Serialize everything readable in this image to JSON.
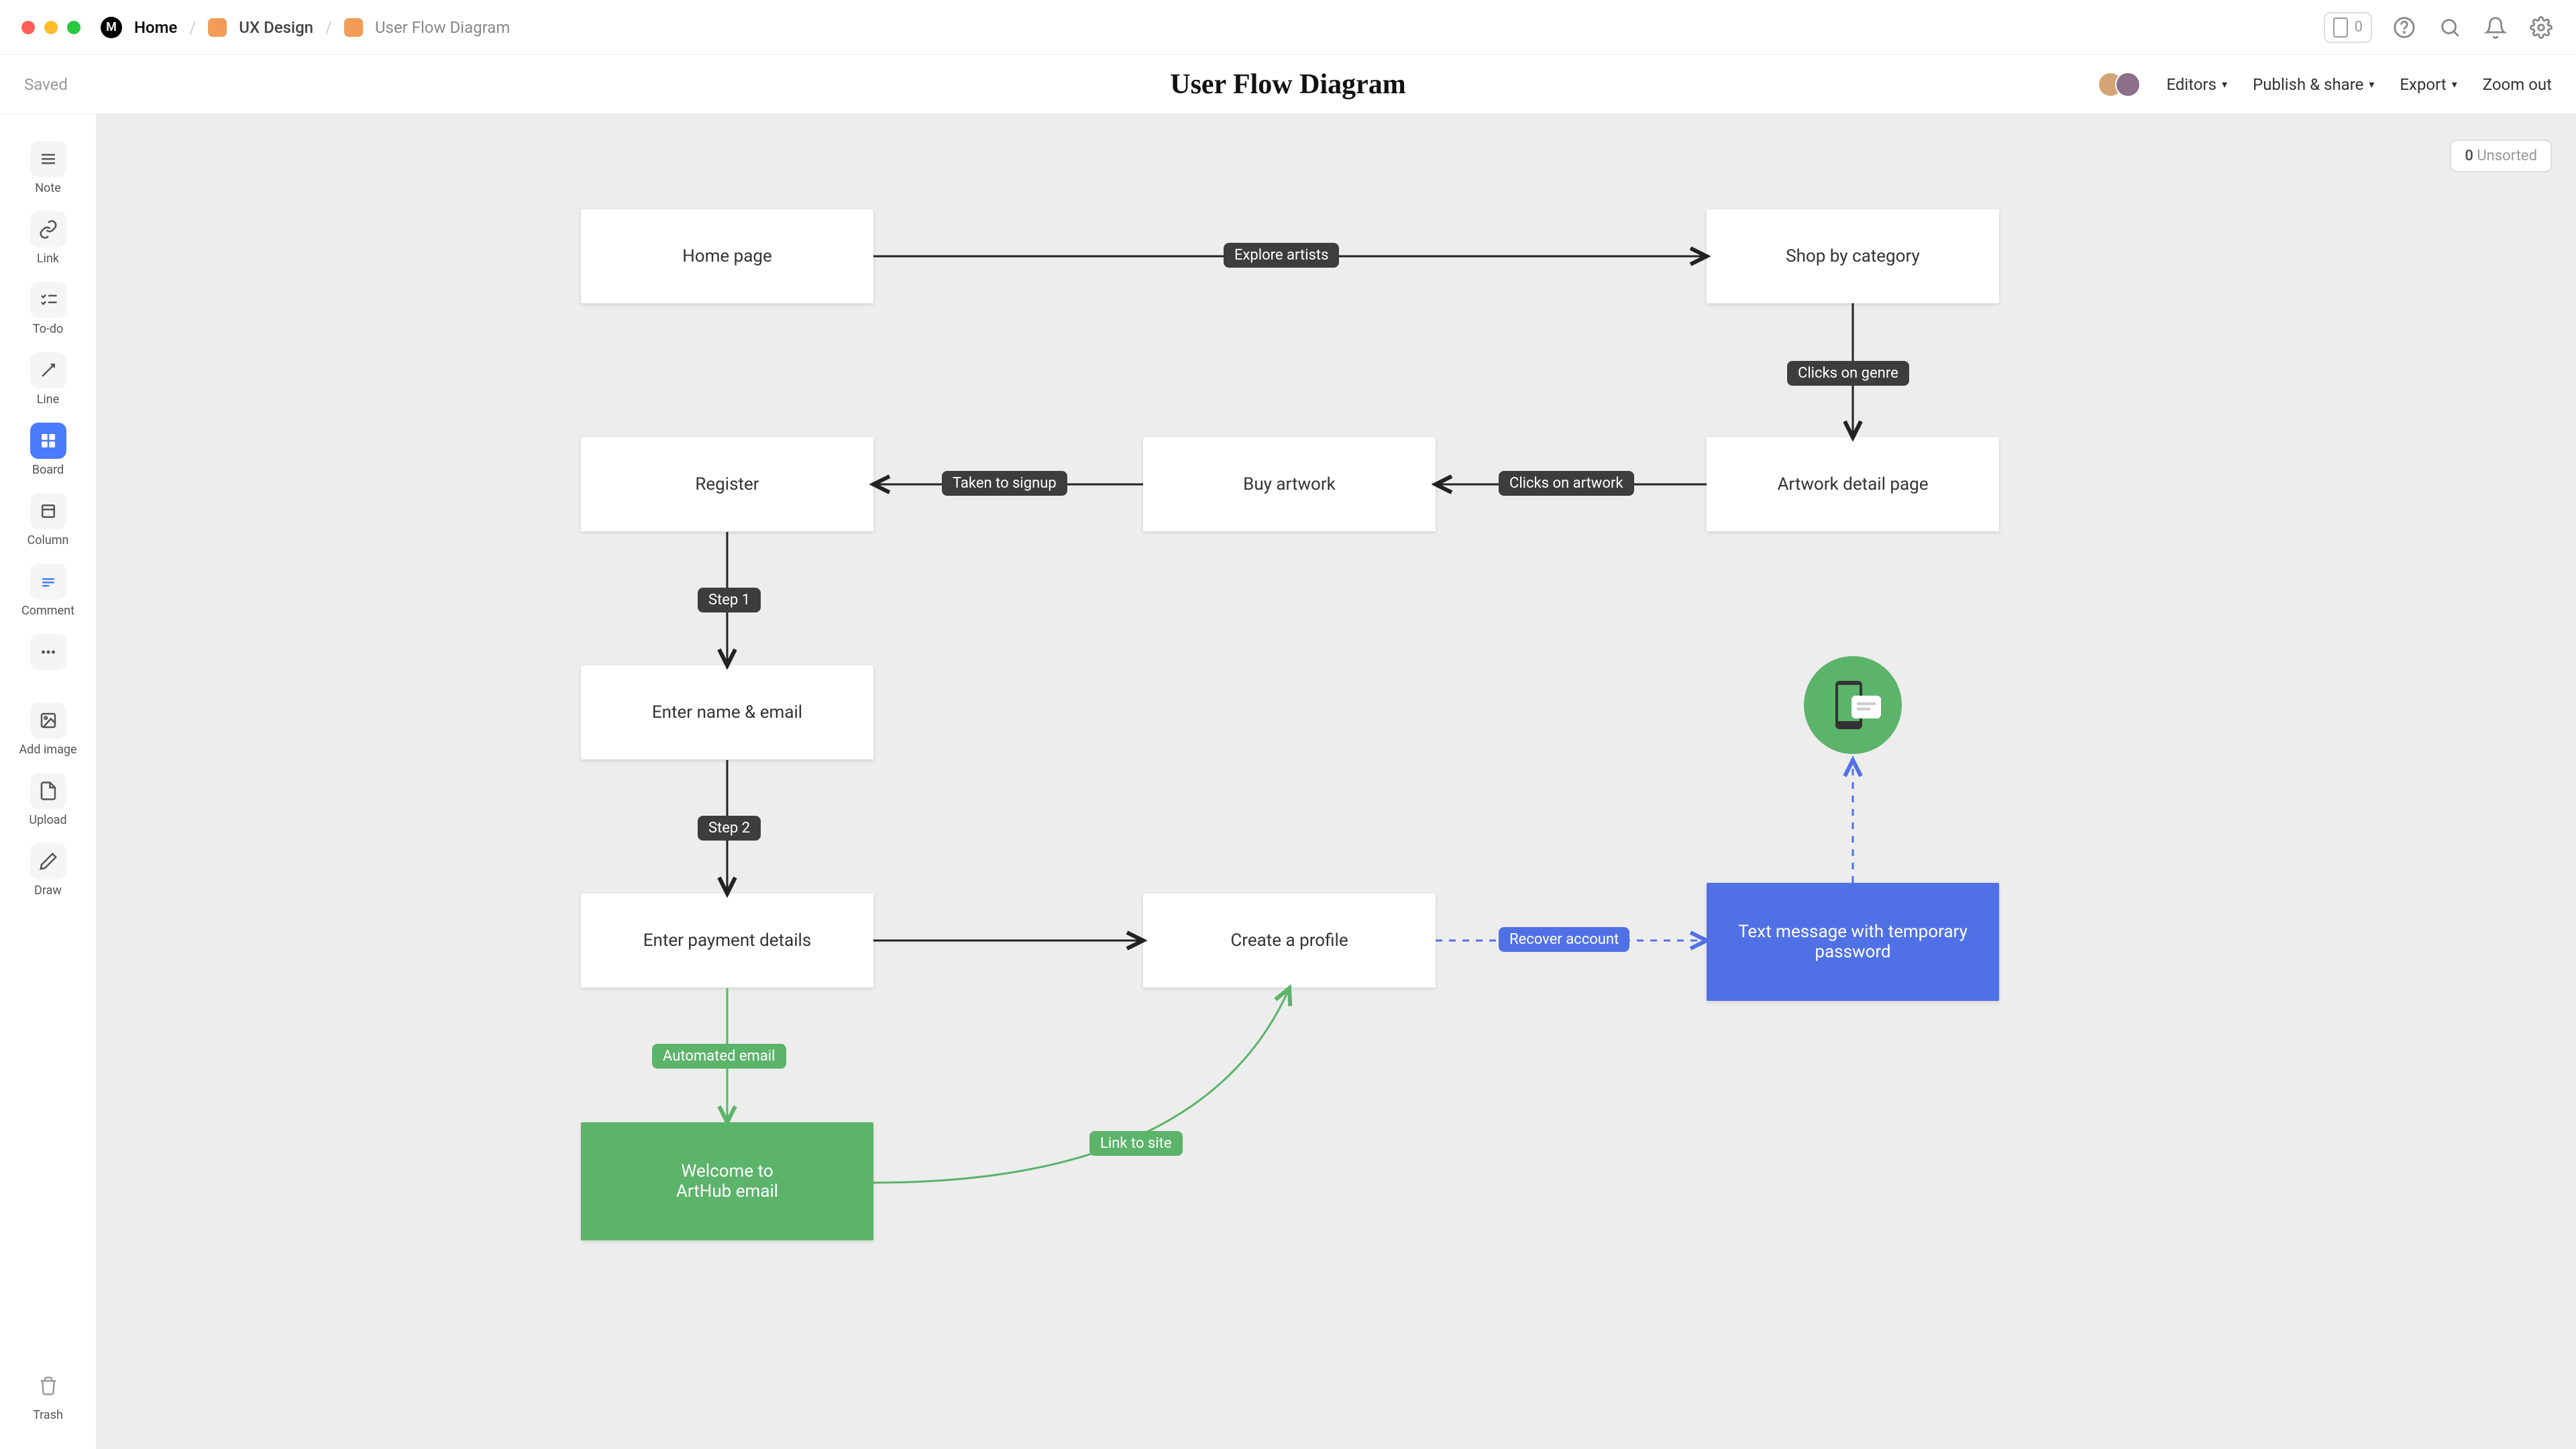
{
  "breadcrumbs": {
    "home": "Home",
    "mid": "UX Design",
    "last": "User Flow Diagram"
  },
  "header": {
    "saved": "Saved",
    "title": "User Flow Diagram",
    "editors": "Editors",
    "publish": "Publish & share",
    "export": "Export",
    "zoom": "Zoom out",
    "badge": "0"
  },
  "unsorted": {
    "count": "0",
    "label": "Unsorted"
  },
  "tools": {
    "note": "Note",
    "link": "Link",
    "todo": "To-do",
    "line": "Line",
    "board": "Board",
    "column": "Column",
    "comment": "Comment",
    "addimage": "Add image",
    "upload": "Upload",
    "draw": "Draw",
    "trash": "Trash"
  },
  "nodes": {
    "home": "Home page",
    "shop": "Shop by category",
    "register": "Register",
    "buy": "Buy artwork",
    "detail": "Artwork detail page",
    "name": "Enter name & email",
    "payment": "Enter payment details",
    "profile": "Create a profile",
    "sms": "Text message with temporary password",
    "welcome1": "Welcome to",
    "welcome2": "ArtHub email"
  },
  "labels": {
    "explore": "Explore artists",
    "genre": "Clicks on genre",
    "artwork": "Clicks on artwork",
    "signup": "Taken to signup",
    "step1": "Step 1",
    "step2": "Step 2",
    "automated": "Automated email",
    "linksite": "Link to site",
    "recover": "Recover account"
  }
}
